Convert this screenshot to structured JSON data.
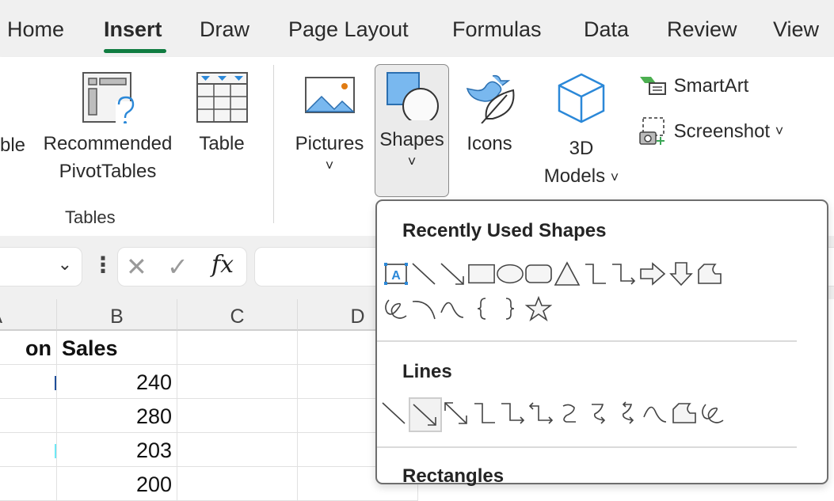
{
  "tabs": [
    {
      "label": "Home",
      "active": false
    },
    {
      "label": "Insert",
      "active": true
    },
    {
      "label": "Draw",
      "active": false
    },
    {
      "label": "Page Layout",
      "active": false
    },
    {
      "label": "Formulas",
      "active": false
    },
    {
      "label": "Data",
      "active": false
    },
    {
      "label": "Review",
      "active": false
    },
    {
      "label": "View",
      "active": false
    }
  ],
  "accent_color": "#107c41",
  "ribbon": {
    "pivot_table_partial": "ble",
    "recommended_pivot_line1": "Recommended",
    "recommended_pivot_line2": "PivotTables",
    "table": "Table",
    "tables_group": "Tables",
    "pictures": "Pictures",
    "shapes": "Shapes",
    "icons": "Icons",
    "models_line1": "3D",
    "models_line2": "Models",
    "smartart": "SmartArt",
    "screenshot": "Screenshot",
    "chevron": "˅"
  },
  "formula_bar": {
    "cancel_icon": "✕",
    "enter_icon": "✓",
    "fx": "fx",
    "more": "⋮"
  },
  "grid": {
    "columns": [
      "A",
      "B",
      "C",
      "D"
    ],
    "rows": [
      {
        "a": "on",
        "b": "Sales"
      },
      {
        "a": "",
        "b": "240"
      },
      {
        "a": "",
        "b": "280"
      },
      {
        "a": "",
        "b": "203"
      },
      {
        "a": "",
        "b": "200"
      }
    ]
  },
  "shapes_menu": {
    "recent_title": "Recently Used Shapes",
    "lines_title": "Lines",
    "rectangles_title": "Rectangles",
    "recent_shapes": [
      "text-box",
      "line",
      "arrow",
      "rectangle",
      "oval",
      "rounded-rectangle",
      "triangle",
      "elbow-connector",
      "elbow-arrow-connector",
      "right-arrow",
      "down-arrow",
      "snip-rectangle",
      "scribble",
      "arc",
      "curve",
      "left-brace",
      "right-brace",
      "star"
    ],
    "line_shapes": [
      "line",
      "arrow",
      "double-arrow",
      "elbow-connector",
      "elbow-arrow-connector",
      "elbow-double-arrow",
      "curved-connector",
      "curved-arrow-connector",
      "curved-double-arrow",
      "curve",
      "freeform",
      "scribble"
    ],
    "selected_line_shape": "arrow"
  }
}
